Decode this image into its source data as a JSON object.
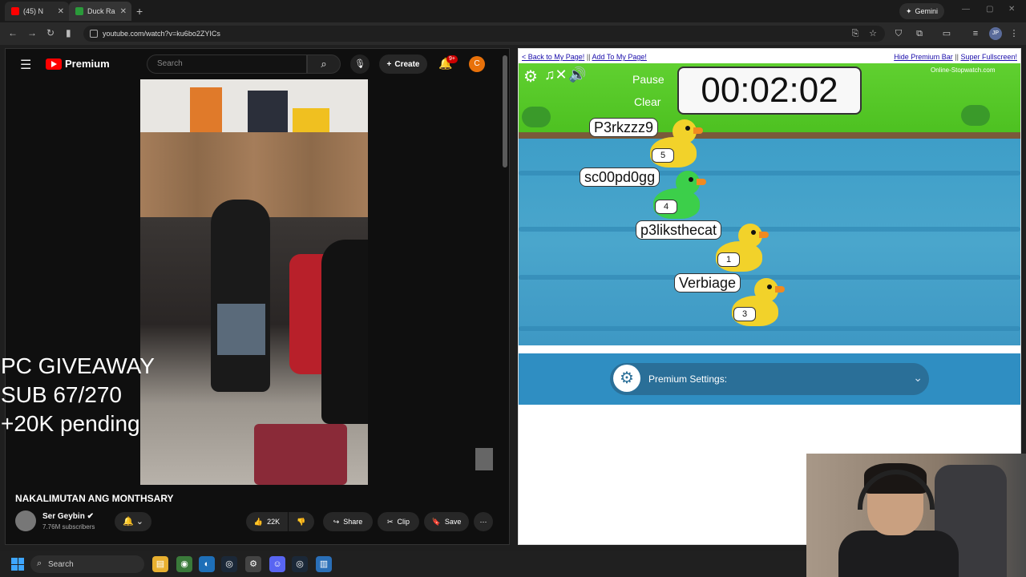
{
  "browser": {
    "tabs": [
      {
        "label": "(45) N",
        "favicon_color": "#ff0000"
      },
      {
        "label": "Duck Ra",
        "favicon_color": "#2a9a3a"
      }
    ],
    "new_tab_symbol": "+",
    "gemini_label": "Gemini",
    "url": "youtube.com/watch?v=ku6bo2ZYICs",
    "profile_initials": "JP"
  },
  "youtube": {
    "logo_text": "Premium",
    "search_placeholder": "Search",
    "create_label": "Create",
    "notif_badge": "9+",
    "user_initial": "C",
    "overlay_lines": "PC GIVEAWAY\nSUB 67/270\n+20K pending",
    "video_title": "NAKALIMUTAN ANG MONTHSARY",
    "channel_name": "Ser Geybin",
    "subscribers": "7.76M subscribers",
    "likes": "22K",
    "share_label": "Share",
    "clip_label": "Clip",
    "save_label": "Save"
  },
  "duckrace": {
    "links_left": [
      "< Back to My Page!",
      "Add To My Page!"
    ],
    "links_right": [
      "Hide Premium Bar",
      "Super Fullscreen!"
    ],
    "pause_label": "Pause",
    "clear_label": "Clear",
    "timer": "00:02:02",
    "brand": "Online-Stopwatch.com",
    "ducks": [
      {
        "name": "P3rkzzz9",
        "number": "5",
        "color": "#f2d22a"
      },
      {
        "name": "sc00pd0gg",
        "number": "4",
        "color": "#3ccf4a"
      },
      {
        "name": "p3liksthecat",
        "number": "1",
        "color": "#f2d22a"
      },
      {
        "name": "Verbiage",
        "number": "3",
        "color": "#f2d22a"
      }
    ],
    "premium_settings_label": "Premium Settings:"
  },
  "taskbar": {
    "search_label": "Search"
  }
}
